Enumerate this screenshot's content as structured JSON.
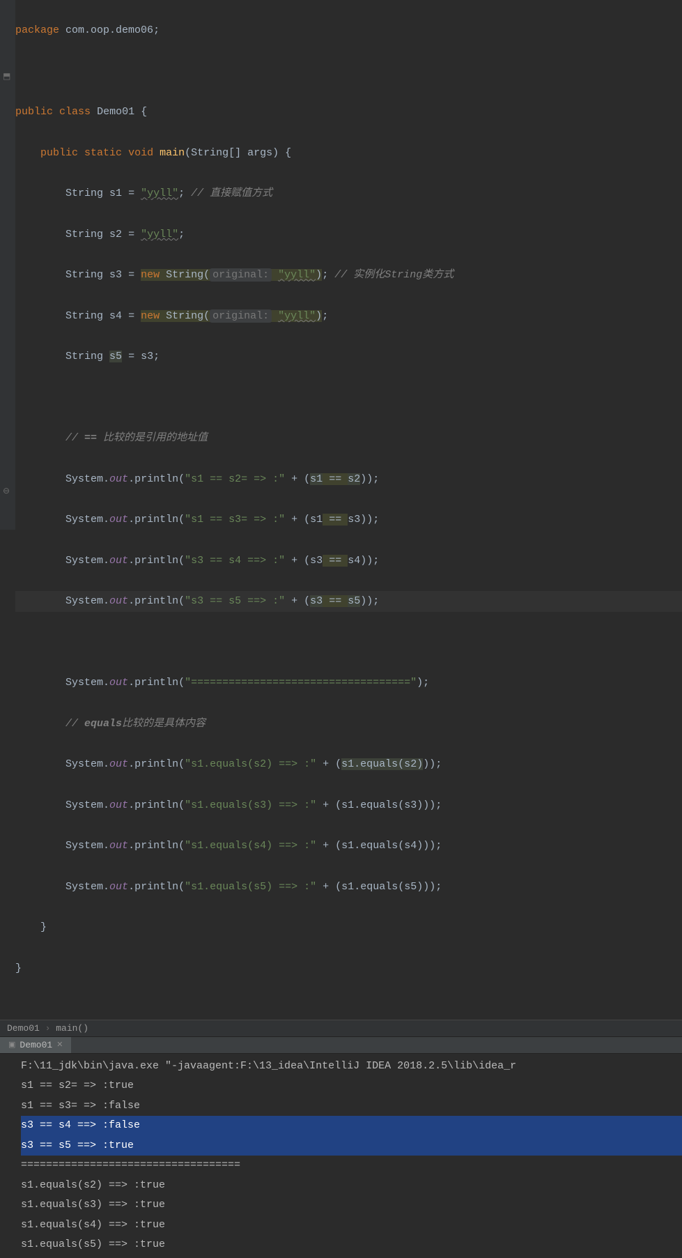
{
  "code": {
    "package_kw": "package",
    "package_name": "com.oop.demo06",
    "public_kw": "public",
    "class_kw": "class",
    "class_name": "Demo01",
    "static_kw": "static",
    "void_kw": "void",
    "main_name": "main",
    "main_params": "(String[] args) {",
    "string_type": "String",
    "s1": "s1",
    "s2": "s2",
    "s3": "s3",
    "s4": "s4",
    "s5": "s5",
    "eq": " = ",
    "yyll": "\"yyll\"",
    "semicolon": ";",
    "comment1": "// 直接赋值方式",
    "new_kw": "new",
    "string_ctor": "String(",
    "hint_original": "original:",
    "close_paren": ")",
    "comment2": "// 实例化String类方式",
    "comment3_pre": "// ",
    "comment3_op": "==",
    "comment3_txt": " 比较的是引用的地址值",
    "system": "System",
    "dot": ".",
    "out": "out",
    "println": "println",
    "open_paren": "(",
    "str_s1s2": "\"s1 == s2= => :\"",
    "str_s1s3": "\"s1 == s3= => :\"",
    "str_s3s4": "\"s3 == s4 ==> :\"",
    "str_s3s5": "\"s3 == s5 ==> :\"",
    "plus": " + ",
    "eqeq": " == ",
    "close2": "));",
    "str_divider": "\"===================================\"",
    "close1": ");",
    "comment4_pre": "// ",
    "comment4_eq": "equals",
    "comment4_txt": "比较的是具体内容",
    "str_eq_s2": "\"s1.equals(s2) ==> :\"",
    "str_eq_s3": "\"s1.equals(s3) ==> :\"",
    "str_eq_s4": "\"s1.equals(s4) ==> :\"",
    "str_eq_s5": "\"s1.equals(s5) ==> :\"",
    "equals_call": ".equals(",
    "close3": ")));"
  },
  "breadcrumb": {
    "cls": "Demo01",
    "method": "main()"
  },
  "tab": {
    "name": "Demo01"
  },
  "console": {
    "l1": "F:\\11_jdk\\bin\\java.exe \"-javaagent:F:\\13_idea\\IntelliJ IDEA 2018.2.5\\lib\\idea_r",
    "l2": "s1 == s2= => :true",
    "l3": "s1 == s3= => :false",
    "l4": "s3 == s4 ==> :false",
    "l5": "s3 == s5 ==> :true",
    "l6": "===================================",
    "l7": "s1.equals(s2) ==> :true",
    "l8": "s1.equals(s3) ==> :true",
    "l9": "s1.equals(s4) ==> :true",
    "l10": "s1.equals(s5) ==> :true"
  }
}
